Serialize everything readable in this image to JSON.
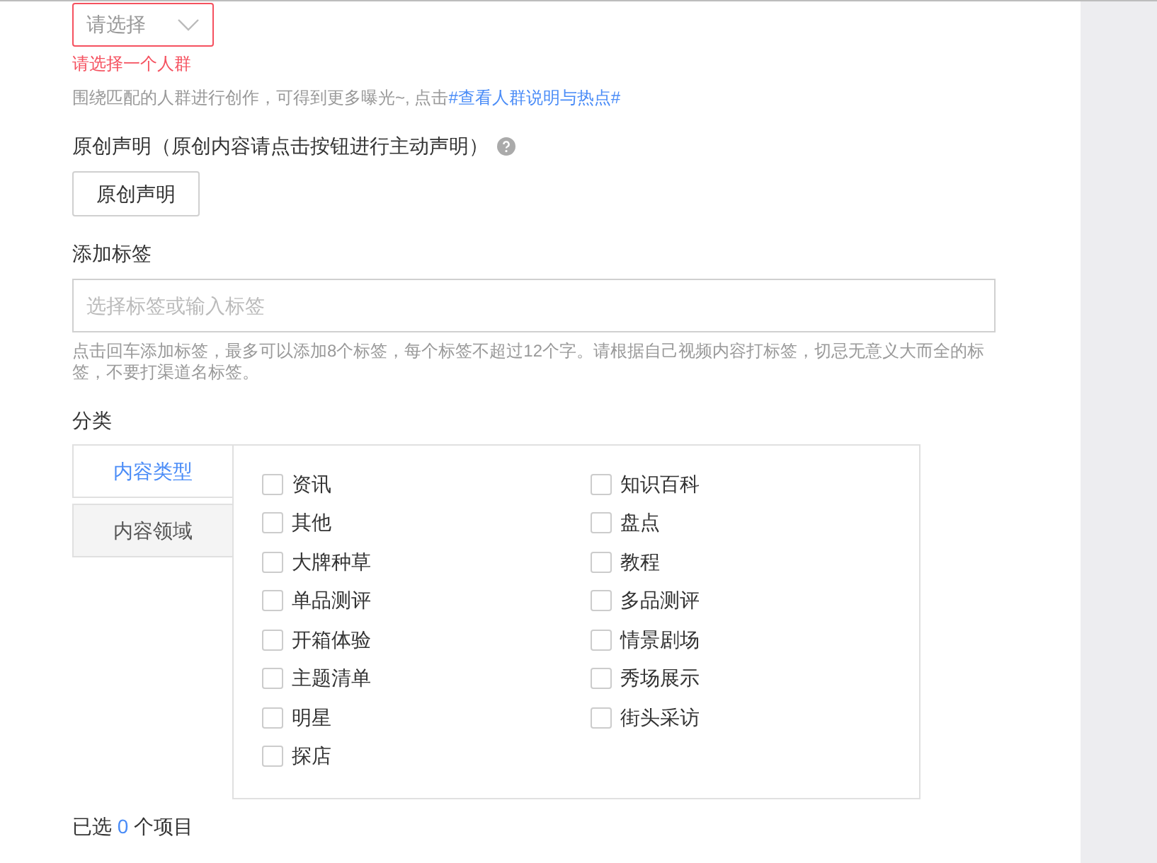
{
  "crowd_select": {
    "placeholder": "请选择",
    "error": true,
    "error_text": "请选择一个人群",
    "hint": "围绕匹配的人群进行创作，可得到更多曝光~, 点击",
    "hint_link": "#查看人群说明与热点#"
  },
  "original": {
    "label": "原创声明（原创内容请点击按钮进行主动声明）",
    "button": "原创声明"
  },
  "tags": {
    "label": "添加标签",
    "placeholder": "选择标签或输入标签",
    "hint": "点击回车添加标签，最多可以添加8个标签，每个标签不超过12个字。请根据自己视频内容打标签，切忌无意义大而全的标签，不要打渠道名标签。"
  },
  "category": {
    "label": "分类",
    "tabs": [
      {
        "label": "内容类型",
        "selected": true
      },
      {
        "label": "内容领域",
        "selected": false
      }
    ],
    "options": [
      {
        "label": "资讯",
        "checked": false
      },
      {
        "label": "知识百科",
        "checked": false
      },
      {
        "label": "其他",
        "checked": false
      },
      {
        "label": "盘点",
        "checked": false
      },
      {
        "label": "大牌种草",
        "checked": false
      },
      {
        "label": "教程",
        "checked": false
      },
      {
        "label": "单品测评",
        "checked": false
      },
      {
        "label": "多品测评",
        "checked": false
      },
      {
        "label": "开箱体验",
        "checked": false
      },
      {
        "label": "情景剧场",
        "checked": false
      },
      {
        "label": "主题清单",
        "checked": false
      },
      {
        "label": "秀场展示",
        "checked": false
      },
      {
        "label": "明星",
        "checked": false
      },
      {
        "label": "街头采访",
        "checked": false
      },
      {
        "label": "探店",
        "checked": false
      }
    ]
  },
  "selection": {
    "prefix": "已选",
    "count": "0",
    "suffix": "个项目"
  }
}
